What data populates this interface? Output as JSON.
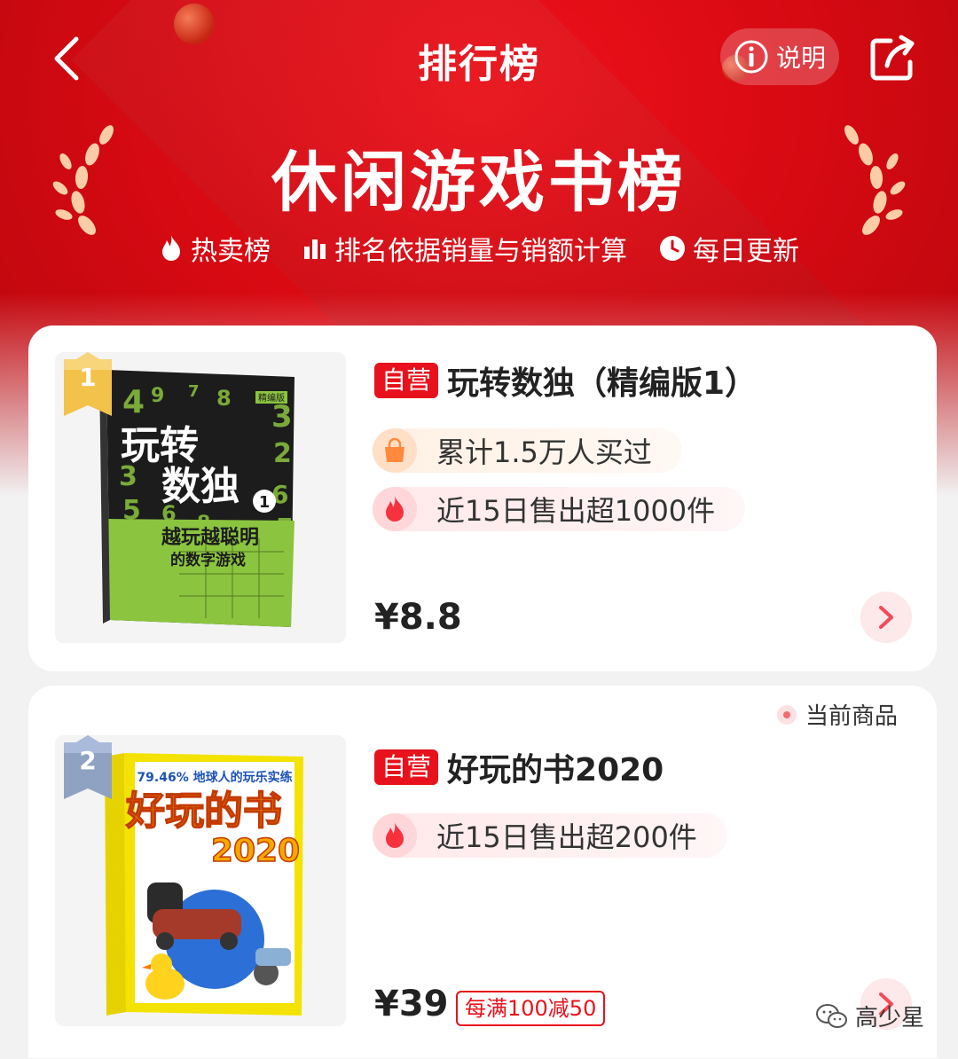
{
  "header": {
    "page_title": "排行榜",
    "explain_label": "说明",
    "ranking_title": "休闲游戏书榜",
    "info": [
      {
        "icon": "flame-icon",
        "label": "热卖榜"
      },
      {
        "icon": "bar-chart-icon",
        "label": "排名依据销量与销额计算"
      },
      {
        "icon": "clock-icon",
        "label": "每日更新"
      }
    ]
  },
  "products": [
    {
      "rank": "1",
      "tag": "自营",
      "title": "玩转数独（精编版1）",
      "bought": "累计1.5万人买过",
      "sold": "近15日售出超1000件",
      "price": "¥8.8",
      "cover": {
        "title_line1": "玩转",
        "title_line2": "数独",
        "edition": "精编版",
        "subtitle1": "越玩越聪明",
        "subtitle2": "的数字游戏",
        "volume": "1"
      }
    },
    {
      "rank": "2",
      "tag": "自营",
      "title": "好玩的书2020",
      "sold": "近15日售出超200件",
      "price": "¥39",
      "promo": "每满100减50",
      "current_label": "当前商品",
      "cover": {
        "top_text": "79.46% 地球人的玩乐实练",
        "title": "好玩的书",
        "year": "2020"
      }
    }
  ],
  "watermark": "高少星",
  "colors": {
    "brand_red": "#e8121c",
    "header_red": "#d90a13",
    "gold": "#f3c24a",
    "silver": "#8fa2c2"
  }
}
